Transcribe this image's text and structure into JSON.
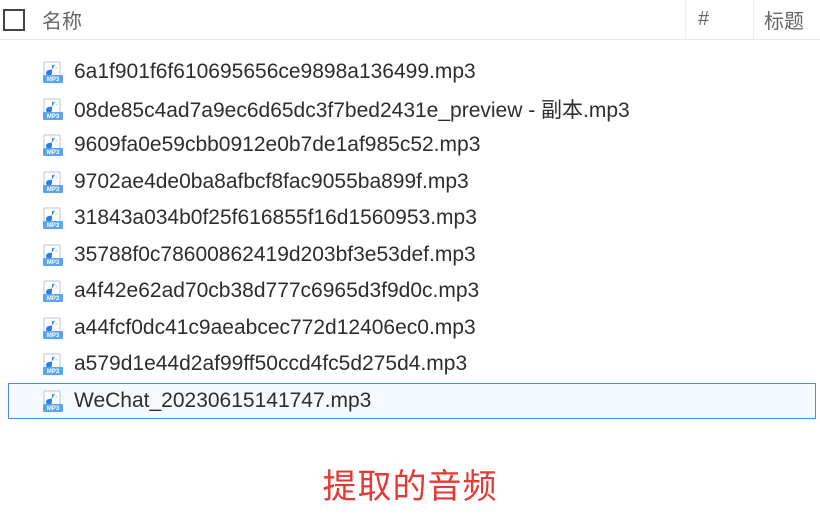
{
  "columns": {
    "name": "名称",
    "hash": "#",
    "title": "标题"
  },
  "files": [
    {
      "name": "6a1f901f6f610695656ce9898a136499.mp3",
      "selected": false
    },
    {
      "name": "08de85c4ad7a9ec6d65dc3f7bed2431e_preview - 副本.mp3",
      "selected": false
    },
    {
      "name": "9609fa0e59cbb0912e0b7de1af985c52.mp3",
      "selected": false
    },
    {
      "name": "9702ae4de0ba8afbcf8fac9055ba899f.mp3",
      "selected": false
    },
    {
      "name": "31843a034b0f25f616855f16d1560953.mp3",
      "selected": false
    },
    {
      "name": "35788f0c78600862419d203bf3e53def.mp3",
      "selected": false
    },
    {
      "name": "a4f42e62ad70cb38d777c6965d3f9d0c.mp3",
      "selected": false
    },
    {
      "name": "a44fcf0dc41c9aeabcec772d12406ec0.mp3",
      "selected": false
    },
    {
      "name": "a579d1e44d2af99ff50ccd4fc5d275d4.mp3",
      "selected": false
    },
    {
      "name": "WeChat_20230615141747.mp3",
      "selected": true
    }
  ],
  "caption": "提取的音频",
  "icon_label": "MP3"
}
